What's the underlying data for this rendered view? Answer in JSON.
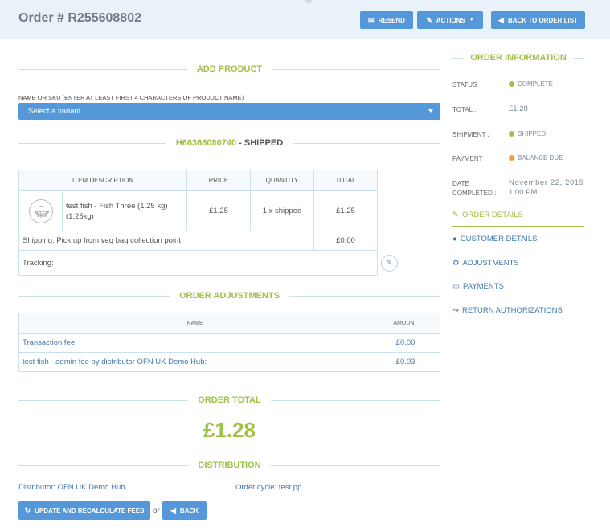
{
  "header": {
    "title": "Order # R255608802",
    "resend_label": "RESEND",
    "actions_label": "ACTIONS",
    "back_to_list_label": "BACK TO ORDER LIST"
  },
  "add_product": {
    "title": "ADD PRODUCT",
    "field_label": "NAME OR SKU (ENTER AT LEAST FIRST 4 CHARACTERS OF PRODUCT NAME)",
    "select_placeholder": "Select a variant"
  },
  "shipment": {
    "number": "H66366080740",
    "state": " - SHIPPED",
    "columns": [
      "ITEM DESCRIPTION",
      "PRICE",
      "QUANTITY",
      "TOTAL"
    ],
    "item": {
      "description": "test fish - Fish Three (1.25 kg) (1.25kg)",
      "price": "£1.25",
      "quantity": "1 x shipped",
      "total": "£1.25"
    },
    "shipping_label": "Shipping: Pick up from veg bag collection point.",
    "shipping_total": "£0.00",
    "tracking_label": "Tracking:"
  },
  "adjustments": {
    "title": "ORDER ADJUSTMENTS",
    "columns": [
      "NAME",
      "AMOUNT"
    ],
    "rows": [
      {
        "name": "Transaction fee:",
        "amount": "£0.00"
      },
      {
        "name": "test fish - admin fee by distributor OFN UK Demo Hub:",
        "amount": "£0.03"
      }
    ]
  },
  "order_total": {
    "title": "ORDER TOTAL",
    "value": "£1.28"
  },
  "distribution": {
    "title": "DISTRIBUTION",
    "distributor_label": "Distributor:",
    "distributor_value": "OFN UK Demo Hub",
    "cycle_label": "Order cycle:",
    "cycle_value": "test pp"
  },
  "footer": {
    "update_label": "UPDATE AND RECALCULATE FEES",
    "or_text": "or",
    "back_label": "BACK"
  },
  "sidebar": {
    "title": "ORDER INFORMATION",
    "status_label": "STATUS",
    "status_value": "COMPLETE",
    "total_label": "TOTAL :",
    "total_value": "£1.28",
    "shipment_label": "SHIPMENT :",
    "shipment_value": "SHIPPED",
    "payment_label": "PAYMENT :",
    "payment_value": "BALANCE DUE",
    "date_label_1": "DATE",
    "date_label_2": "COMPLETED :",
    "date_value_1": "November 22, 2019",
    "date_value_2": "1:00 PM",
    "links": [
      "ORDER DETAILS",
      "CUSTOMER DETAILS",
      "ADJUSTMENTS",
      "PAYMENTS",
      "RETURN AUTHORIZATIONS"
    ]
  },
  "colors": {
    "accent_blue": "#5498da",
    "accent_green": "#9fc14a",
    "status_complete": "#9fc14a",
    "status_balance_due": "#f0a030"
  }
}
